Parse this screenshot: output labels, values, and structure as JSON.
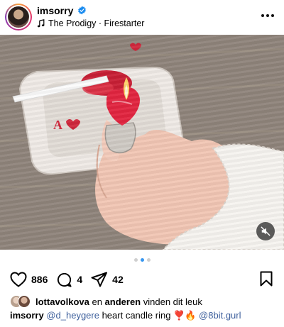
{
  "post": {
    "username": "imsorry",
    "verified_icon": "verified-badge-icon",
    "music_icon": "music-note-icon",
    "music_title": "The Prodigy · Firestarter",
    "more_icon": "more-options-icon"
  },
  "media": {
    "description_icon": "photo",
    "mute_icon": "speaker-muted-icon",
    "carousel": {
      "count": 3,
      "active_index": 1
    }
  },
  "actions": {
    "like_count": "886",
    "comment_count": "4",
    "share_count": "42",
    "icons": [
      "heart-icon",
      "comment-icon",
      "share-icon",
      "bookmark-icon"
    ]
  },
  "likes": {
    "first_user": "lottavolkova",
    "connector": " en ",
    "others": "anderen",
    "suffix": " vinden dit leuk"
  },
  "caption": {
    "author": "imsorry",
    "mention1": "@d_heygere",
    "text": " heart candle ring ",
    "emojis": "❣️🔥",
    "mention2": "@8bit.gurl"
  },
  "colors": {
    "accent_blue": "#3897f0",
    "mention_color": "#3d5f9c",
    "candle_red": "#e2243f"
  }
}
